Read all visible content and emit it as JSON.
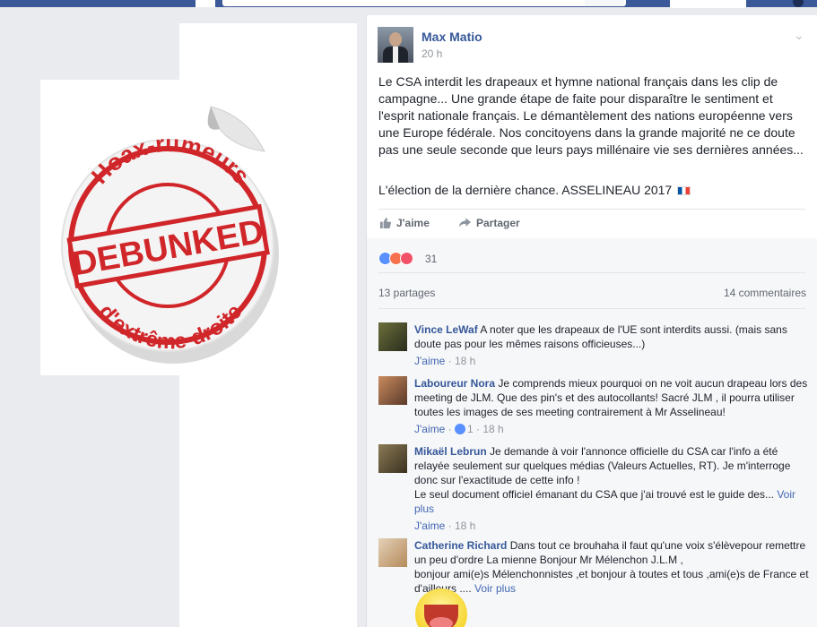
{
  "post": {
    "author": "Max Matio",
    "time": "20 h",
    "body": "Le CSA interdit les drapeaux et hymne national français dans les clip de campagne... Une grande étape de faite pour disparaître le sentiment et l'esprit nationale français. Le démantèlement des nations européenne vers une Europe fédérale. Nos concitoyens dans la grande majorité ne ce doute pas une seule seconde que leurs pays millénaire vie ses dernières années...",
    "body2": "L'élection de la dernière chance. ASSELINEAU 2017",
    "like_label": "J'aime",
    "share_label": "Partager",
    "reaction_count": "31",
    "shares": "13 partages",
    "comments_count": "14 commentaires"
  },
  "image": {
    "stamp_top": "Hoax-rumeurs",
    "stamp_center": "DEBUNKED",
    "stamp_bottom": "d'extrême-droite",
    "accent": "#d0262a"
  },
  "comments": [
    {
      "name": "Vince LeWaf",
      "text": " A noter que les drapeaux de l'UE sont interdits aussi. (mais sans doute pas pour les mêmes raisons officieuses...)",
      "like": "J'aime",
      "time": "18 h"
    },
    {
      "name": "Laboureur Nora",
      "text": " Je comprends mieux pourquoi on ne voit aucun drapeau lors des meeting de JLM. Que des pin's et des autocollants! Sacré JLM , il pourra utiliser toutes les images de ses meeting contrairement à Mr Asselineau!",
      "like": "J'aime",
      "likes": "1",
      "time": "18 h"
    },
    {
      "name": "Mikaël Lebrun",
      "text": " Je demande à voir l'annonce officielle du CSA car l'info a été relayée seulement sur quelques médias (Valeurs Actuelles, RT). Je m'interroge donc sur l'exactitude de cette info !",
      "text2": "Le seul document officiel émanant du CSA que j'ai trouvé est le guide des...",
      "more": "Voir plus",
      "like": "J'aime",
      "time": "18 h"
    },
    {
      "name": "Catherine Richard",
      "text": " Dans tout ce brouhaha il faut qu'une voix s'élèvepour remettre un peu d'ordre La mienne Bonjour Mr Mélenchon J.L.M ,",
      "text2": "bonjour ami(e)s Mélenchonnistes ,et bonjour à toutes et tous ,ami(e)s de France et d'ailleurs ....",
      "more": "Voir plus"
    }
  ]
}
